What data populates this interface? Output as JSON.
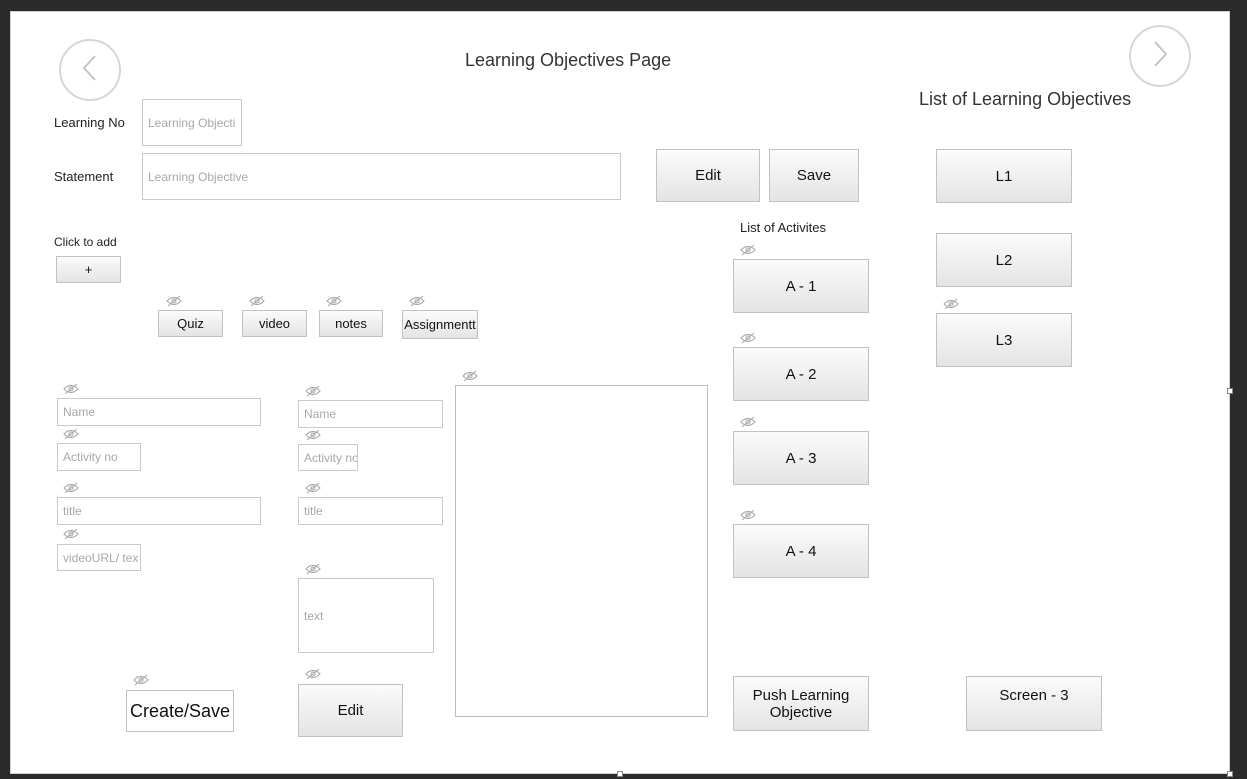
{
  "page": {
    "title": "Learning Objectives Page",
    "objectives_list_title": "List of Learning Objectives",
    "activities_list_title": "List of Activites"
  },
  "form": {
    "learning_no_label": "Learning No",
    "learning_no_placeholder": "Learning Objecti",
    "statement_label": "Statement",
    "statement_placeholder": "Learning Objective",
    "edit_label": "Edit",
    "save_label": "Save",
    "click_to_add_label": "Click to add",
    "add_button_label": "+"
  },
  "activity_types": [
    "Quiz",
    "video",
    "notes",
    "Assignmentt"
  ],
  "video_form": {
    "name_placeholder": "Name",
    "activity_no_placeholder": "Activity no",
    "title_placeholder": "title",
    "url_placeholder": "videoURL/ tex",
    "create_save_label": "Create/Save"
  },
  "notes_form": {
    "name_placeholder": "Name",
    "activity_no_placeholder": "Activity no",
    "title_placeholder": "title",
    "text_placeholder": "text",
    "edit_label": "Edit"
  },
  "activities": [
    "A - 1",
    "A - 2",
    "A - 3",
    "A - 4"
  ],
  "push_button_label": "Push Learning Objective",
  "objectives": [
    "L1",
    "L2",
    "L3"
  ],
  "screen_button_label": "Screen - 3",
  "icons": {
    "back": "chevron-left-icon",
    "forward": "chevron-right-icon",
    "visibility": "eye-off-icon"
  }
}
